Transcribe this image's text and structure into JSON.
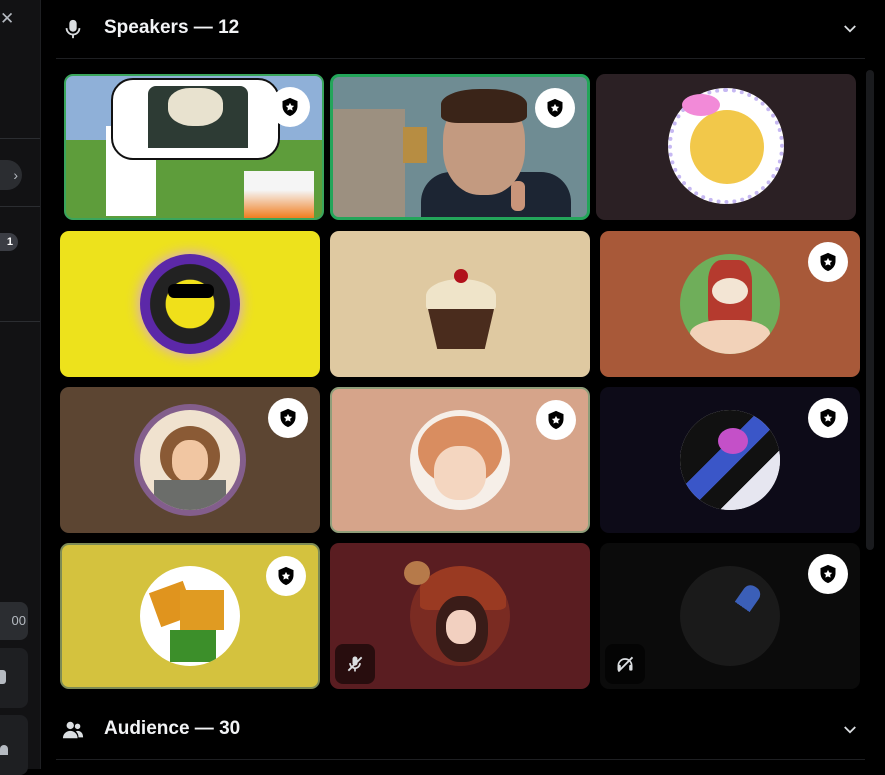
{
  "speakers": {
    "title": "Speakers — 12"
  },
  "audience": {
    "title": "Audience — 30"
  },
  "left_strip": {
    "badge_count": "1",
    "pill_text": "00"
  },
  "icons": {
    "speakers_header": "microphone-icon",
    "audience_header": "people-icon",
    "collapse": "chevron-down-icon",
    "moderator": "shield-star-icon",
    "muted": "mic-muted-icon",
    "deafened": "headset-off-icon"
  },
  "colors": {
    "speaking_outline": "#23a55a",
    "background": "#000000"
  },
  "tiles": [
    {
      "name": "speaker-1",
      "moderator": true,
      "speaking": true
    },
    {
      "name": "speaker-2-video",
      "moderator": true,
      "speaking": true,
      "video": true
    },
    {
      "name": "speaker-3",
      "moderator": false
    },
    {
      "name": "speaker-4",
      "moderator": false
    },
    {
      "name": "speaker-5",
      "moderator": false
    },
    {
      "name": "speaker-6",
      "moderator": true
    },
    {
      "name": "speaker-7",
      "moderator": true
    },
    {
      "name": "speaker-8",
      "moderator": true,
      "speaking": true
    },
    {
      "name": "speaker-9",
      "moderator": true
    },
    {
      "name": "speaker-10",
      "moderator": true,
      "speaking": true
    },
    {
      "name": "speaker-11",
      "moderator": false,
      "muted": true
    },
    {
      "name": "speaker-12",
      "moderator": true,
      "deafened": true
    }
  ]
}
